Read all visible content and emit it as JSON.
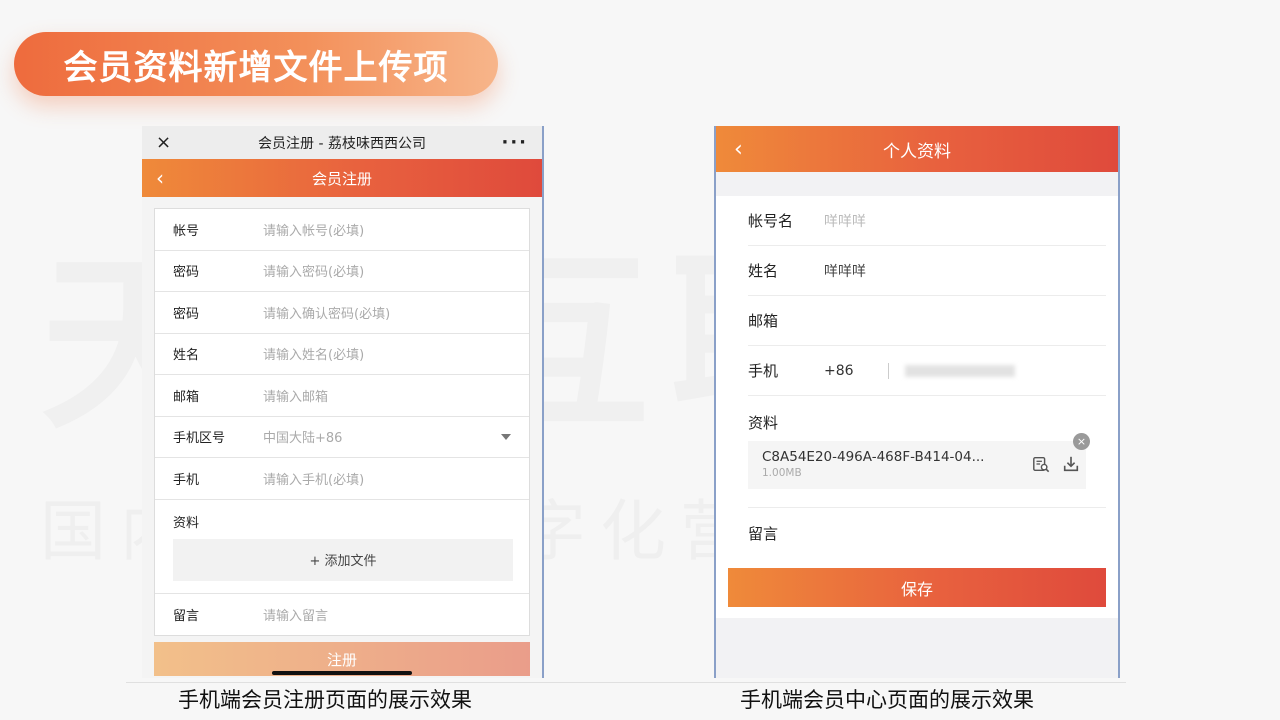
{
  "slide": {
    "title": "会员资料新增文件上传项",
    "watermark_main": "天橘互联",
    "watermark_sub": "国内领先的数字化营销服务商",
    "accent_color": "#e8613e",
    "caption_left": "手机端会员注册页面的展示效果",
    "caption_right": "手机端会员中心页面的展示效果"
  },
  "register": {
    "wechat_title": "会员注册 - 荔枝味西西公司",
    "close_icon": "×",
    "more_icon": "···",
    "back_icon": "‹",
    "header_title": "会员注册",
    "fields": [
      {
        "label": "帐号",
        "placeholder": "请输入帐号(必填)"
      },
      {
        "label": "密码",
        "placeholder": "请输入密码(必填)"
      },
      {
        "label": "密码",
        "placeholder": "请输入确认密码(必填)"
      },
      {
        "label": "姓名",
        "placeholder": "请输入姓名(必填)"
      },
      {
        "label": "邮箱",
        "placeholder": "请输入邮箱"
      },
      {
        "label": "手机区号",
        "placeholder": "中国大陆+86"
      },
      {
        "label": "手机",
        "placeholder": "请输入手机(必填)"
      }
    ],
    "upload_label": "资料",
    "add_file_label": "+ 添加文件",
    "message_label": "留言",
    "message_placeholder": "请输入留言",
    "submit_label": "注册"
  },
  "profile": {
    "back_icon": "‹",
    "header_title": "个人资料",
    "account_label": "帐号名",
    "account_value": "咩咩咩",
    "name_label": "姓名",
    "name_value": "咩咩咩",
    "email_label": "邮箱",
    "phone_label": "手机",
    "phone_code": "+86",
    "file_label": "资料",
    "file_name": "C8A54E20-496A-468F-B414-04...",
    "file_size": "1.00MB",
    "close_icon": "×",
    "message_label": "留言",
    "save_label": "保存"
  }
}
